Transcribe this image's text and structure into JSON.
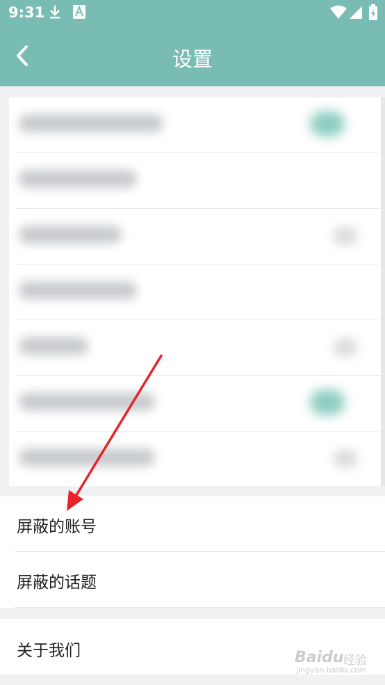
{
  "status_bar": {
    "time": "9:31",
    "icons": [
      "download-icon",
      "a-icon",
      "wifi-icon",
      "signal-icon",
      "battery-icon"
    ]
  },
  "header": {
    "title": "设置",
    "back_icon": "back-arrow-icon"
  },
  "blurred_section": {
    "row_count": 7,
    "toggle_rows": [
      1,
      6
    ],
    "toggle_color": "#8ccdc1"
  },
  "menu_groups": [
    {
      "items": [
        {
          "label": "屏蔽的账号"
        },
        {
          "label": "屏蔽的话题"
        }
      ]
    },
    {
      "items": [
        {
          "label": "关于我们"
        }
      ]
    }
  ],
  "annotation": {
    "type": "red-arrow",
    "color": "#e8222a",
    "points_to": "屏蔽的账号"
  },
  "watermark": {
    "logo": "Baidu",
    "sub": "经验",
    "url": "jingyan.baidu.com"
  },
  "colors": {
    "header": "#78bcb3",
    "background": "#f0f1f3"
  }
}
